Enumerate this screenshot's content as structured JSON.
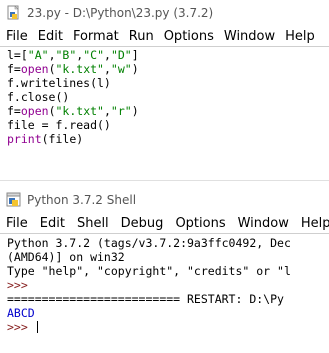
{
  "editor": {
    "title": "23.py - D:\\Python\\23.py (3.7.2)",
    "menu": [
      "File",
      "Edit",
      "Format",
      "Run",
      "Options",
      "Window",
      "Help"
    ],
    "code": [
      [
        {
          "t": "l=[",
          "c": ""
        },
        {
          "t": "\"A\"",
          "c": "str"
        },
        {
          "t": ",",
          "c": ""
        },
        {
          "t": "\"B\"",
          "c": "str"
        },
        {
          "t": ",",
          "c": ""
        },
        {
          "t": "\"C\"",
          "c": "str"
        },
        {
          "t": ",",
          "c": ""
        },
        {
          "t": "\"D\"",
          "c": "str"
        },
        {
          "t": "]",
          "c": ""
        }
      ],
      [
        {
          "t": "f=",
          "c": ""
        },
        {
          "t": "open",
          "c": "bi"
        },
        {
          "t": "(",
          "c": ""
        },
        {
          "t": "\"k.txt\"",
          "c": "str"
        },
        {
          "t": ",",
          "c": ""
        },
        {
          "t": "\"w\"",
          "c": "str"
        },
        {
          "t": ")",
          "c": ""
        }
      ],
      [
        {
          "t": "f.writelines(l)",
          "c": ""
        }
      ],
      [
        {
          "t": "f.close()",
          "c": ""
        }
      ],
      [
        {
          "t": "f=",
          "c": ""
        },
        {
          "t": "open",
          "c": "bi"
        },
        {
          "t": "(",
          "c": ""
        },
        {
          "t": "\"k.txt\"",
          "c": "str"
        },
        {
          "t": ",",
          "c": ""
        },
        {
          "t": "\"r\"",
          "c": "str"
        },
        {
          "t": ")",
          "c": ""
        }
      ],
      [
        {
          "t": "file = f.read()",
          "c": ""
        }
      ],
      [
        {
          "t": "print",
          "c": "bi"
        },
        {
          "t": "(file)",
          "c": ""
        }
      ]
    ]
  },
  "shell": {
    "title": "Python 3.7.2 Shell",
    "menu": [
      "File",
      "Edit",
      "Shell",
      "Debug",
      "Options",
      "Window",
      "Help"
    ],
    "lines": [
      [
        {
          "t": "Python 3.7.2 (tags/v3.7.2:9a3ffc0492, Dec",
          "c": ""
        }
      ],
      [
        {
          "t": "(AMD64)] on win32",
          "c": ""
        }
      ],
      [
        {
          "t": "Type \"help\", \"copyright\", \"credits\" or \"l",
          "c": ""
        }
      ],
      [
        {
          "t": ">>>",
          "c": "prm"
        }
      ],
      [
        {
          "t": "========================= RESTART: D:\\Py",
          "c": ""
        }
      ],
      [
        {
          "t": "ABCD",
          "c": "out"
        }
      ],
      [
        {
          "t": ">>> ",
          "c": "prm"
        }
      ]
    ]
  },
  "colors": {
    "string": "#008000",
    "builtin": "#900090",
    "output": "#0000cc",
    "prompt": "#882222"
  }
}
